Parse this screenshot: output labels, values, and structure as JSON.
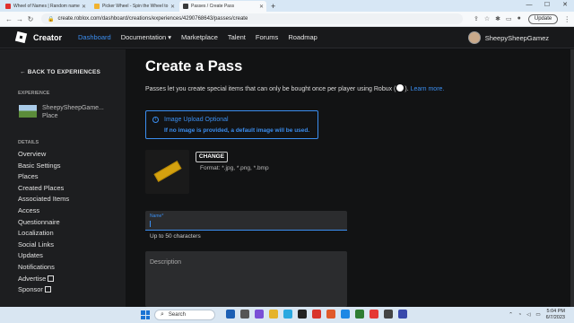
{
  "browser": {
    "tabs": [
      {
        "title": "Wheel of Names | Random name",
        "color": "#e0312e",
        "active": false
      },
      {
        "title": "Picker Wheel - Spin the Wheel to",
        "color": "#f1b22f",
        "active": false
      },
      {
        "title": "Passes / Create Pass",
        "color": "#3a3a3a",
        "active": true
      }
    ],
    "url": "create.roblox.com/dashboard/creations/experiences/4290768643/passes/create",
    "update_label": "Update"
  },
  "topnav": {
    "brand": "Creator",
    "items": [
      "Dashboard",
      "Documentation ▾",
      "Marketplace",
      "Talent",
      "Forums",
      "Roadmap"
    ],
    "username": "SheepySheepGamez"
  },
  "sidebar": {
    "back_label": "BACK TO EXPERIENCES",
    "experience_heading": "EXPERIENCE",
    "experience_name": "SheepySheepGame...",
    "experience_sub": "Place",
    "details_heading": "DETAILS",
    "items": [
      "Overview",
      "Basic Settings",
      "Places",
      "Created Places",
      "Associated Items",
      "Access",
      "Questionnaire",
      "Localization",
      "Social Links",
      "Updates",
      "Notifications",
      "Advertise",
      "Sponsor"
    ]
  },
  "main": {
    "title": "Create a Pass",
    "description": "Passes let you create special items that can only be bought once per player using Robux (",
    "description_end": ").",
    "learn_more": "Learn more.",
    "info_title": "Image Upload Optional",
    "info_body": "If no image is provided, a default image will be used.",
    "change_label": "CHANGE",
    "format_text": "Format: *.jpg, *.png, *.bmp",
    "name_label": "Name*",
    "name_helper": "Up to 50 characters",
    "description_placeholder": "Description"
  },
  "taskbar": {
    "search_label": "Search",
    "time": "5:04 PM",
    "date": "6/7/2023"
  }
}
